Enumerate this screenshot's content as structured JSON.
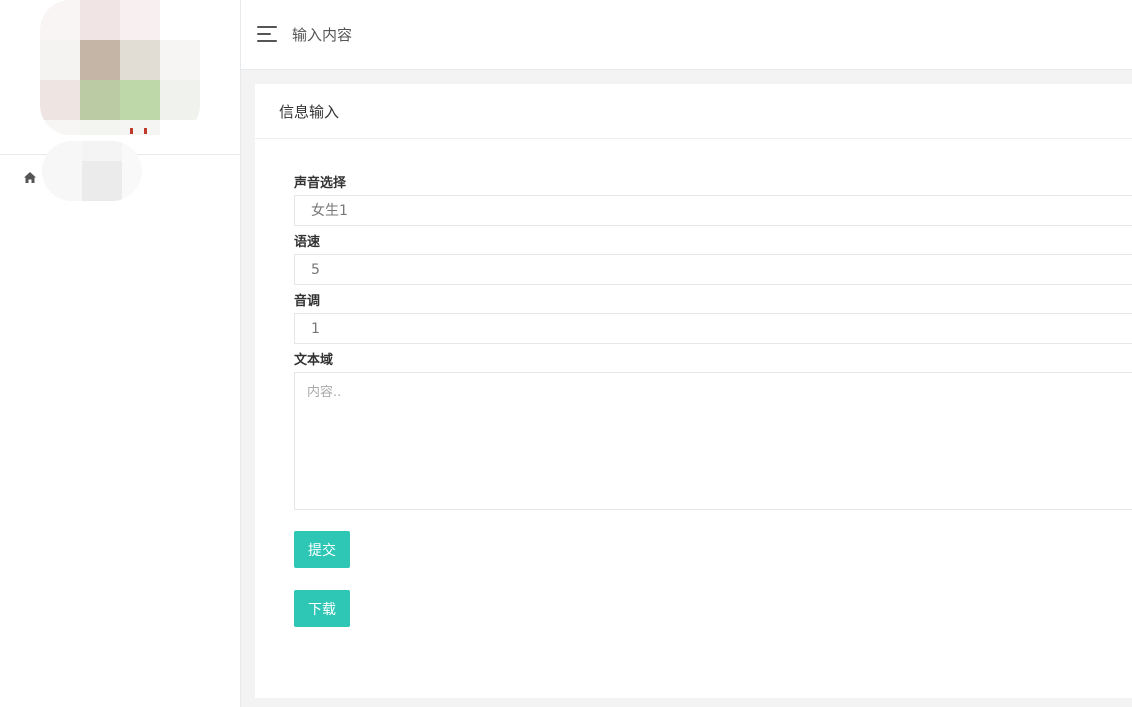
{
  "sidebar": {
    "home_icon": "home-icon"
  },
  "topbar": {
    "menu_icon": "hamburger-menu-icon",
    "title": "输入内容"
  },
  "card": {
    "title": "信息输入"
  },
  "form": {
    "voice": {
      "label": "声音选择",
      "value": "女生1"
    },
    "speed": {
      "label": "语速",
      "value": "5"
    },
    "pitch": {
      "label": "音调",
      "value": "1"
    },
    "text": {
      "label": "文本域",
      "placeholder": "内容.."
    },
    "submit_label": "提交",
    "download_label": "下载"
  },
  "colors": {
    "accent": "#2ec7b6",
    "background": "#f3f3f4"
  }
}
